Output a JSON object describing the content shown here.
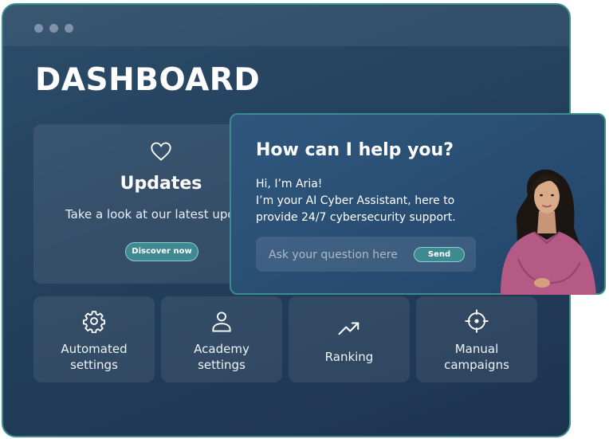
{
  "window": {
    "title": "DASHBOARD"
  },
  "updates": {
    "icon": "heart-icon",
    "title": "Updates",
    "subtitle": "Take a look at our latest upd",
    "button_label": "Discover now"
  },
  "tiles": [
    {
      "icon": "gear-icon",
      "line1": "Automated",
      "line2": "settings"
    },
    {
      "icon": "user-icon",
      "line1": "Academy",
      "line2": "settings"
    },
    {
      "icon": "trending-up-icon",
      "line1": "Ranking",
      "line2": ""
    },
    {
      "icon": "target-icon",
      "line1": "Manual",
      "line2": "campaigns"
    }
  ],
  "chat": {
    "title": "How can I help you?",
    "lines": [
      "Hi, I’m Aria!",
      "I’m your AI Cyber Assistant, here to",
      "provide 24/7 cybersecurity support."
    ],
    "input_placeholder": "Ask your question here",
    "input_value": "",
    "send_label": "Send"
  },
  "colors": {
    "accent": "#3f8a90",
    "window_border": "#3a8c8f",
    "background": "#24405c"
  }
}
